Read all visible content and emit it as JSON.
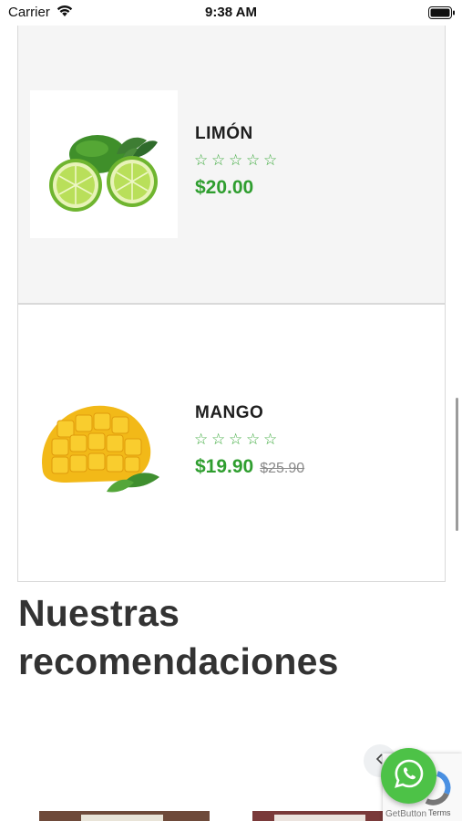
{
  "status_bar": {
    "carrier": "Carrier",
    "time": "9:38 AM"
  },
  "products": [
    {
      "name": "LIMÓN",
      "image_icon": "lime-fruit-image",
      "rating_stars": 5,
      "rating_filled": 0,
      "price": "$20.00",
      "old_price": ""
    },
    {
      "name": "MANGO",
      "image_icon": "mango-fruit-image",
      "rating_stars": 5,
      "rating_filled": 0,
      "price": "$19.90",
      "old_price": "$25.90"
    }
  ],
  "section": {
    "title": "Nuestras recomendaciones"
  },
  "recaptcha": {
    "terms_label": "Terms"
  },
  "getbutton": {
    "label": "GetButton"
  },
  "colors": {
    "accent_green": "#2f9e2f",
    "whatsapp_green": "#4dc247",
    "card_alt_bg": "#f5f5f5"
  }
}
